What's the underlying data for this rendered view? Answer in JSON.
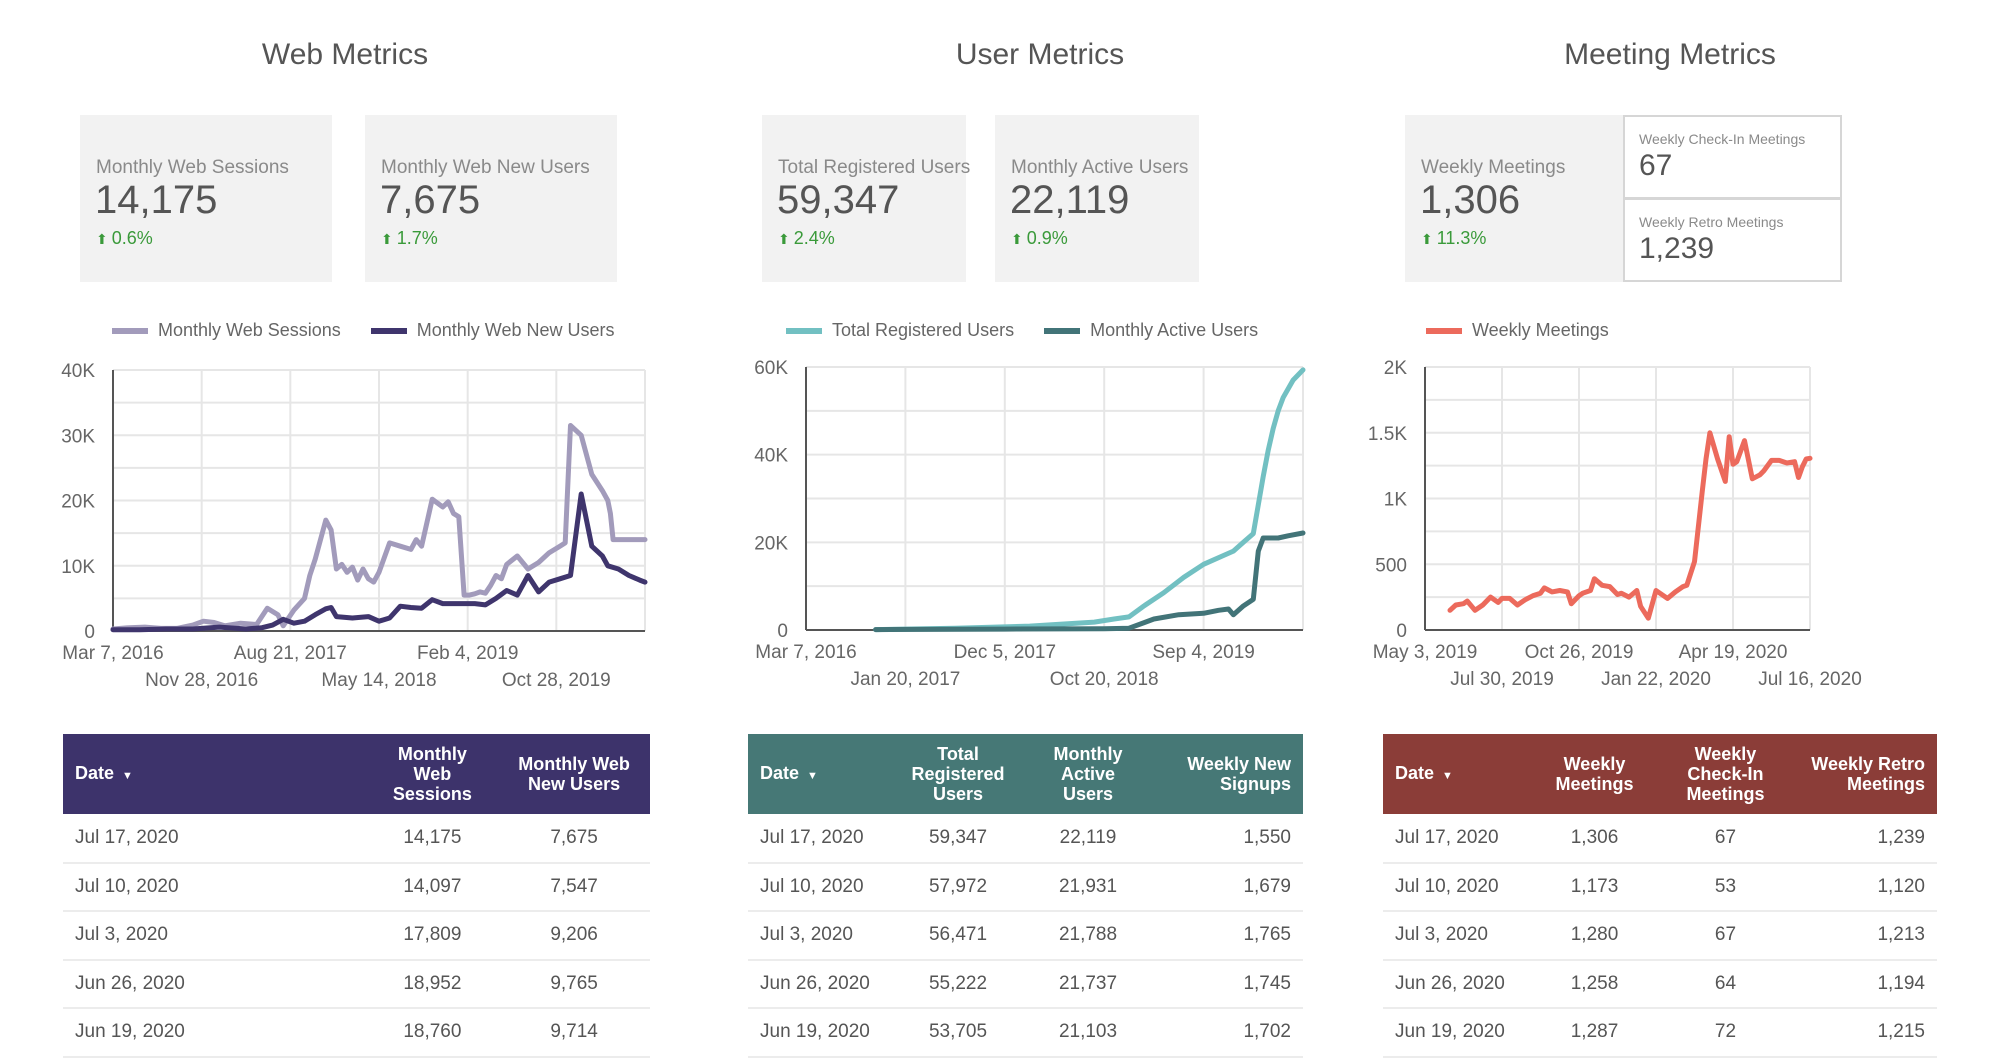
{
  "sections": {
    "web": {
      "title": "Web Metrics",
      "scorecards": [
        {
          "label": "Monthly Web Sessions",
          "value": "14,175",
          "delta": "0.6%",
          "delta_direction": "up"
        },
        {
          "label": "Monthly Web New Users",
          "value": "7,675",
          "delta": "1.7%",
          "delta_direction": "up"
        }
      ],
      "legend": [
        {
          "label": "Monthly Web Sessions",
          "color": "#a29bbb"
        },
        {
          "label": "Monthly Web New Users",
          "color": "#3f356d"
        }
      ],
      "table": {
        "header_color": "#3d336b",
        "columns": [
          "Date",
          "Monthly Web Sessions",
          "Monthly Web New Users"
        ],
        "sort_icon": "sort-desc-icon",
        "rows": [
          [
            "Jul 17, 2020",
            "14,175",
            "7,675"
          ],
          [
            "Jul 10, 2020",
            "14,097",
            "7,547"
          ],
          [
            "Jul 3, 2020",
            "17,809",
            "9,206"
          ],
          [
            "Jun 26, 2020",
            "18,952",
            "9,765"
          ],
          [
            "Jun 19, 2020",
            "18,760",
            "9,714"
          ]
        ]
      }
    },
    "user": {
      "title": "User Metrics",
      "scorecards": [
        {
          "label": "Total Registered Users",
          "value": "59,347",
          "delta": "2.4%",
          "delta_direction": "up"
        },
        {
          "label": "Monthly Active Users",
          "value": "22,119",
          "delta": "0.9%",
          "delta_direction": "up"
        }
      ],
      "legend": [
        {
          "label": "Total Registered Users",
          "color": "#72c0c2"
        },
        {
          "label": "Monthly Active Users",
          "color": "#427478"
        }
      ],
      "table": {
        "header_color": "#467876",
        "columns": [
          "Date",
          "Total Registered Users",
          "Monthly Active Users",
          "Weekly New Signups"
        ],
        "sort_icon": "sort-desc-icon",
        "rows": [
          [
            "Jul 17, 2020",
            "59,347",
            "22,119",
            "1,550"
          ],
          [
            "Jul 10, 2020",
            "57,972",
            "21,931",
            "1,679"
          ],
          [
            "Jul 3, 2020",
            "56,471",
            "21,788",
            "1,765"
          ],
          [
            "Jun 26, 2020",
            "55,222",
            "21,737",
            "1,745"
          ],
          [
            "Jun 19, 2020",
            "53,705",
            "21,103",
            "1,702"
          ]
        ]
      }
    },
    "meeting": {
      "title": "Meeting Metrics",
      "scorecards": [
        {
          "label": "Weekly Meetings",
          "value": "1,306",
          "delta": "11.3%",
          "delta_direction": "up"
        }
      ],
      "mini_cards": [
        {
          "label": "Weekly Check-In Meetings",
          "value": "67"
        },
        {
          "label": "Weekly Retro Meetings",
          "value": "1,239"
        }
      ],
      "legend": [
        {
          "label": "Weekly Meetings",
          "color": "#ec6a5c"
        }
      ],
      "table": {
        "header_color": "#8b3d38",
        "columns": [
          "Date",
          "Weekly Meetings",
          "Weekly Check-In Meetings",
          "Weekly Retro Meetings"
        ],
        "sort_icon": "sort-desc-icon",
        "rows": [
          [
            "Jul 17, 2020",
            "1,306",
            "67",
            "1,239"
          ],
          [
            "Jul 10, 2020",
            "1,173",
            "53",
            "1,120"
          ],
          [
            "Jul 3, 2020",
            "1,280",
            "67",
            "1,213"
          ],
          [
            "Jun 26, 2020",
            "1,258",
            "64",
            "1,194"
          ],
          [
            "Jun 19, 2020",
            "1,287",
            "72",
            "1,215"
          ]
        ]
      }
    }
  },
  "chart_data": [
    {
      "type": "line",
      "title": "Web Metrics",
      "xlabel": "",
      "ylabel": "",
      "ylim": [
        0,
        40000
      ],
      "yticks": [
        0,
        10000,
        20000,
        30000,
        40000
      ],
      "ytick_labels": [
        "0",
        "10K",
        "20K",
        "30K",
        "40K"
      ],
      "xlim": [
        0,
        1
      ],
      "xticks": [
        0,
        0.1667,
        0.3333,
        0.5,
        0.6667,
        0.8333
      ],
      "xtick_labels": [
        "Mar 7, 2016",
        "Nov 28, 2016",
        "Aug 21, 2017",
        "May 14, 2018",
        "Feb 4, 2019",
        "Oct 28, 2019"
      ],
      "grid": true,
      "legend": "top",
      "series": [
        {
          "name": "Monthly Web Sessions",
          "color": "#a29bbb",
          "x": [
            0,
            0.03,
            0.06,
            0.09,
            0.12,
            0.15,
            0.17,
            0.19,
            0.21,
            0.24,
            0.27,
            0.29,
            0.31,
            0.32,
            0.34,
            0.36,
            0.37,
            0.38,
            0.4,
            0.41,
            0.42,
            0.43,
            0.44,
            0.45,
            0.46,
            0.47,
            0.48,
            0.49,
            0.5,
            0.52,
            0.54,
            0.56,
            0.57,
            0.58,
            0.6,
            0.62,
            0.63,
            0.64,
            0.65,
            0.66,
            0.67,
            0.68,
            0.69,
            0.7,
            0.71,
            0.72,
            0.73,
            0.74,
            0.76,
            0.78,
            0.8,
            0.82,
            0.84,
            0.85,
            0.86,
            0.88,
            0.9,
            0.92,
            0.93,
            0.935,
            0.94,
            0.95,
            0.97,
            0.98,
            0.99,
            1.0
          ],
          "y": [
            300,
            500,
            600,
            400,
            400,
            900,
            1500,
            1300,
            800,
            1200,
            1000,
            3500,
            2500,
            800,
            3200,
            5000,
            8500,
            11000,
            17000,
            15500,
            9500,
            10200,
            9000,
            9800,
            7800,
            9500,
            8000,
            7500,
            9000,
            13500,
            13000,
            12500,
            14000,
            13000,
            20200,
            19000,
            19800,
            18000,
            17500,
            5500,
            5500,
            5700,
            6000,
            5800,
            7000,
            8500,
            8000,
            10200,
            11500,
            9500,
            10500,
            12000,
            13000,
            13500,
            31500,
            30000,
            24000,
            21500,
            20000,
            18000,
            14000,
            14000,
            14000,
            14000,
            14000,
            14000
          ]
        },
        {
          "name": "Monthly Web New Users",
          "color": "#3f356d",
          "x": [
            0,
            0.05,
            0.1,
            0.15,
            0.2,
            0.25,
            0.28,
            0.3,
            0.32,
            0.34,
            0.36,
            0.38,
            0.4,
            0.41,
            0.42,
            0.45,
            0.48,
            0.5,
            0.52,
            0.54,
            0.56,
            0.58,
            0.6,
            0.62,
            0.64,
            0.66,
            0.68,
            0.7,
            0.72,
            0.74,
            0.76,
            0.78,
            0.8,
            0.82,
            0.84,
            0.86,
            0.88,
            0.9,
            0.92,
            0.93,
            0.95,
            0.97,
            0.99,
            1.0
          ],
          "y": [
            200,
            200,
            300,
            300,
            600,
            300,
            500,
            900,
            1800,
            1200,
            1500,
            2500,
            3400,
            3600,
            2200,
            2000,
            2200,
            1500,
            2000,
            3800,
            3600,
            3500,
            4800,
            4200,
            4200,
            4200,
            4200,
            4000,
            5000,
            6200,
            5500,
            8500,
            6000,
            7500,
            8000,
            8500,
            21000,
            13000,
            11500,
            10000,
            9500,
            8500,
            7800,
            7500
          ]
        }
      ]
    },
    {
      "type": "line",
      "title": "User Metrics",
      "xlabel": "",
      "ylabel": "",
      "ylim": [
        0,
        60000
      ],
      "yticks": [
        0,
        20000,
        40000,
        60000
      ],
      "ytick_labels": [
        "0",
        "20K",
        "40K",
        "60K"
      ],
      "xlim": [
        0,
        1
      ],
      "xticks": [
        0,
        0.2,
        0.4,
        0.6,
        0.8
      ],
      "xtick_labels": [
        "Mar 7, 2016",
        "Jan 20, 2017",
        "Dec 5, 2017",
        "Oct 20, 2018",
        "Sep 4, 2019"
      ],
      "grid": true,
      "legend": "top",
      "series": [
        {
          "name": "Total Registered Users",
          "color": "#72c0c2",
          "x": [
            0.14,
            0.3,
            0.45,
            0.58,
            0.62,
            0.65,
            0.68,
            0.72,
            0.76,
            0.8,
            0.84,
            0.86,
            0.88,
            0.9,
            0.92,
            0.93,
            0.94,
            0.95,
            0.96,
            0.98,
            1.0
          ],
          "y": [
            100,
            400,
            900,
            1800,
            2500,
            3000,
            5500,
            8500,
            12000,
            15000,
            17000,
            18000,
            20000,
            22000,
            35000,
            41000,
            46000,
            50000,
            53000,
            57000,
            59347
          ]
        },
        {
          "name": "Monthly Active Users",
          "color": "#427478",
          "x": [
            0.14,
            0.4,
            0.6,
            0.65,
            0.7,
            0.75,
            0.8,
            0.83,
            0.85,
            0.86,
            0.88,
            0.9,
            0.91,
            0.92,
            0.93,
            0.95,
            0.97,
            1.0
          ],
          "y": [
            100,
            200,
            300,
            400,
            2500,
            3500,
            3800,
            4500,
            4800,
            3500,
            5500,
            7000,
            18000,
            21000,
            21000,
            21000,
            21500,
            22119
          ]
        }
      ]
    },
    {
      "type": "line",
      "title": "Meeting Metrics",
      "xlabel": "",
      "ylabel": "",
      "ylim": [
        0,
        2000
      ],
      "yticks": [
        0,
        500,
        1000,
        1500,
        2000
      ],
      "ytick_labels": [
        "0",
        "500",
        "1K",
        "1.5K",
        "2K"
      ],
      "xlim": [
        0,
        1
      ],
      "xticks": [
        0,
        0.2,
        0.4,
        0.6,
        0.8,
        1.0
      ],
      "xtick_labels": [
        "May 3, 2019",
        "Jul 30, 2019",
        "Oct 26, 2019",
        "Jan 22, 2020",
        "Apr 19, 2020",
        "Jul 16, 2020"
      ],
      "grid": true,
      "legend": "top",
      "series": [
        {
          "name": "Weekly Meetings",
          "color": "#ec6a5c",
          "x": [
            0.065,
            0.08,
            0.1,
            0.11,
            0.13,
            0.15,
            0.17,
            0.19,
            0.2,
            0.22,
            0.24,
            0.26,
            0.28,
            0.3,
            0.31,
            0.33,
            0.35,
            0.37,
            0.38,
            0.4,
            0.41,
            0.43,
            0.44,
            0.46,
            0.48,
            0.5,
            0.51,
            0.53,
            0.55,
            0.56,
            0.58,
            0.6,
            0.63,
            0.65,
            0.67,
            0.68,
            0.7,
            0.72,
            0.73,
            0.74,
            0.76,
            0.78,
            0.79,
            0.8,
            0.81,
            0.83,
            0.85,
            0.87,
            0.88,
            0.9,
            0.92,
            0.94,
            0.96,
            0.97,
            0.98,
            0.99,
            1.0
          ],
          "y": [
            150,
            190,
            200,
            220,
            150,
            190,
            250,
            210,
            240,
            240,
            190,
            230,
            260,
            280,
            320,
            290,
            300,
            290,
            200,
            260,
            280,
            300,
            390,
            340,
            330,
            270,
            280,
            250,
            300,
            180,
            90,
            300,
            240,
            290,
            330,
            340,
            520,
            1050,
            1300,
            1500,
            1300,
            1130,
            1470,
            1260,
            1280,
            1440,
            1150,
            1180,
            1210,
            1290,
            1290,
            1270,
            1280,
            1160,
            1240,
            1300,
            1306
          ]
        }
      ]
    }
  ]
}
